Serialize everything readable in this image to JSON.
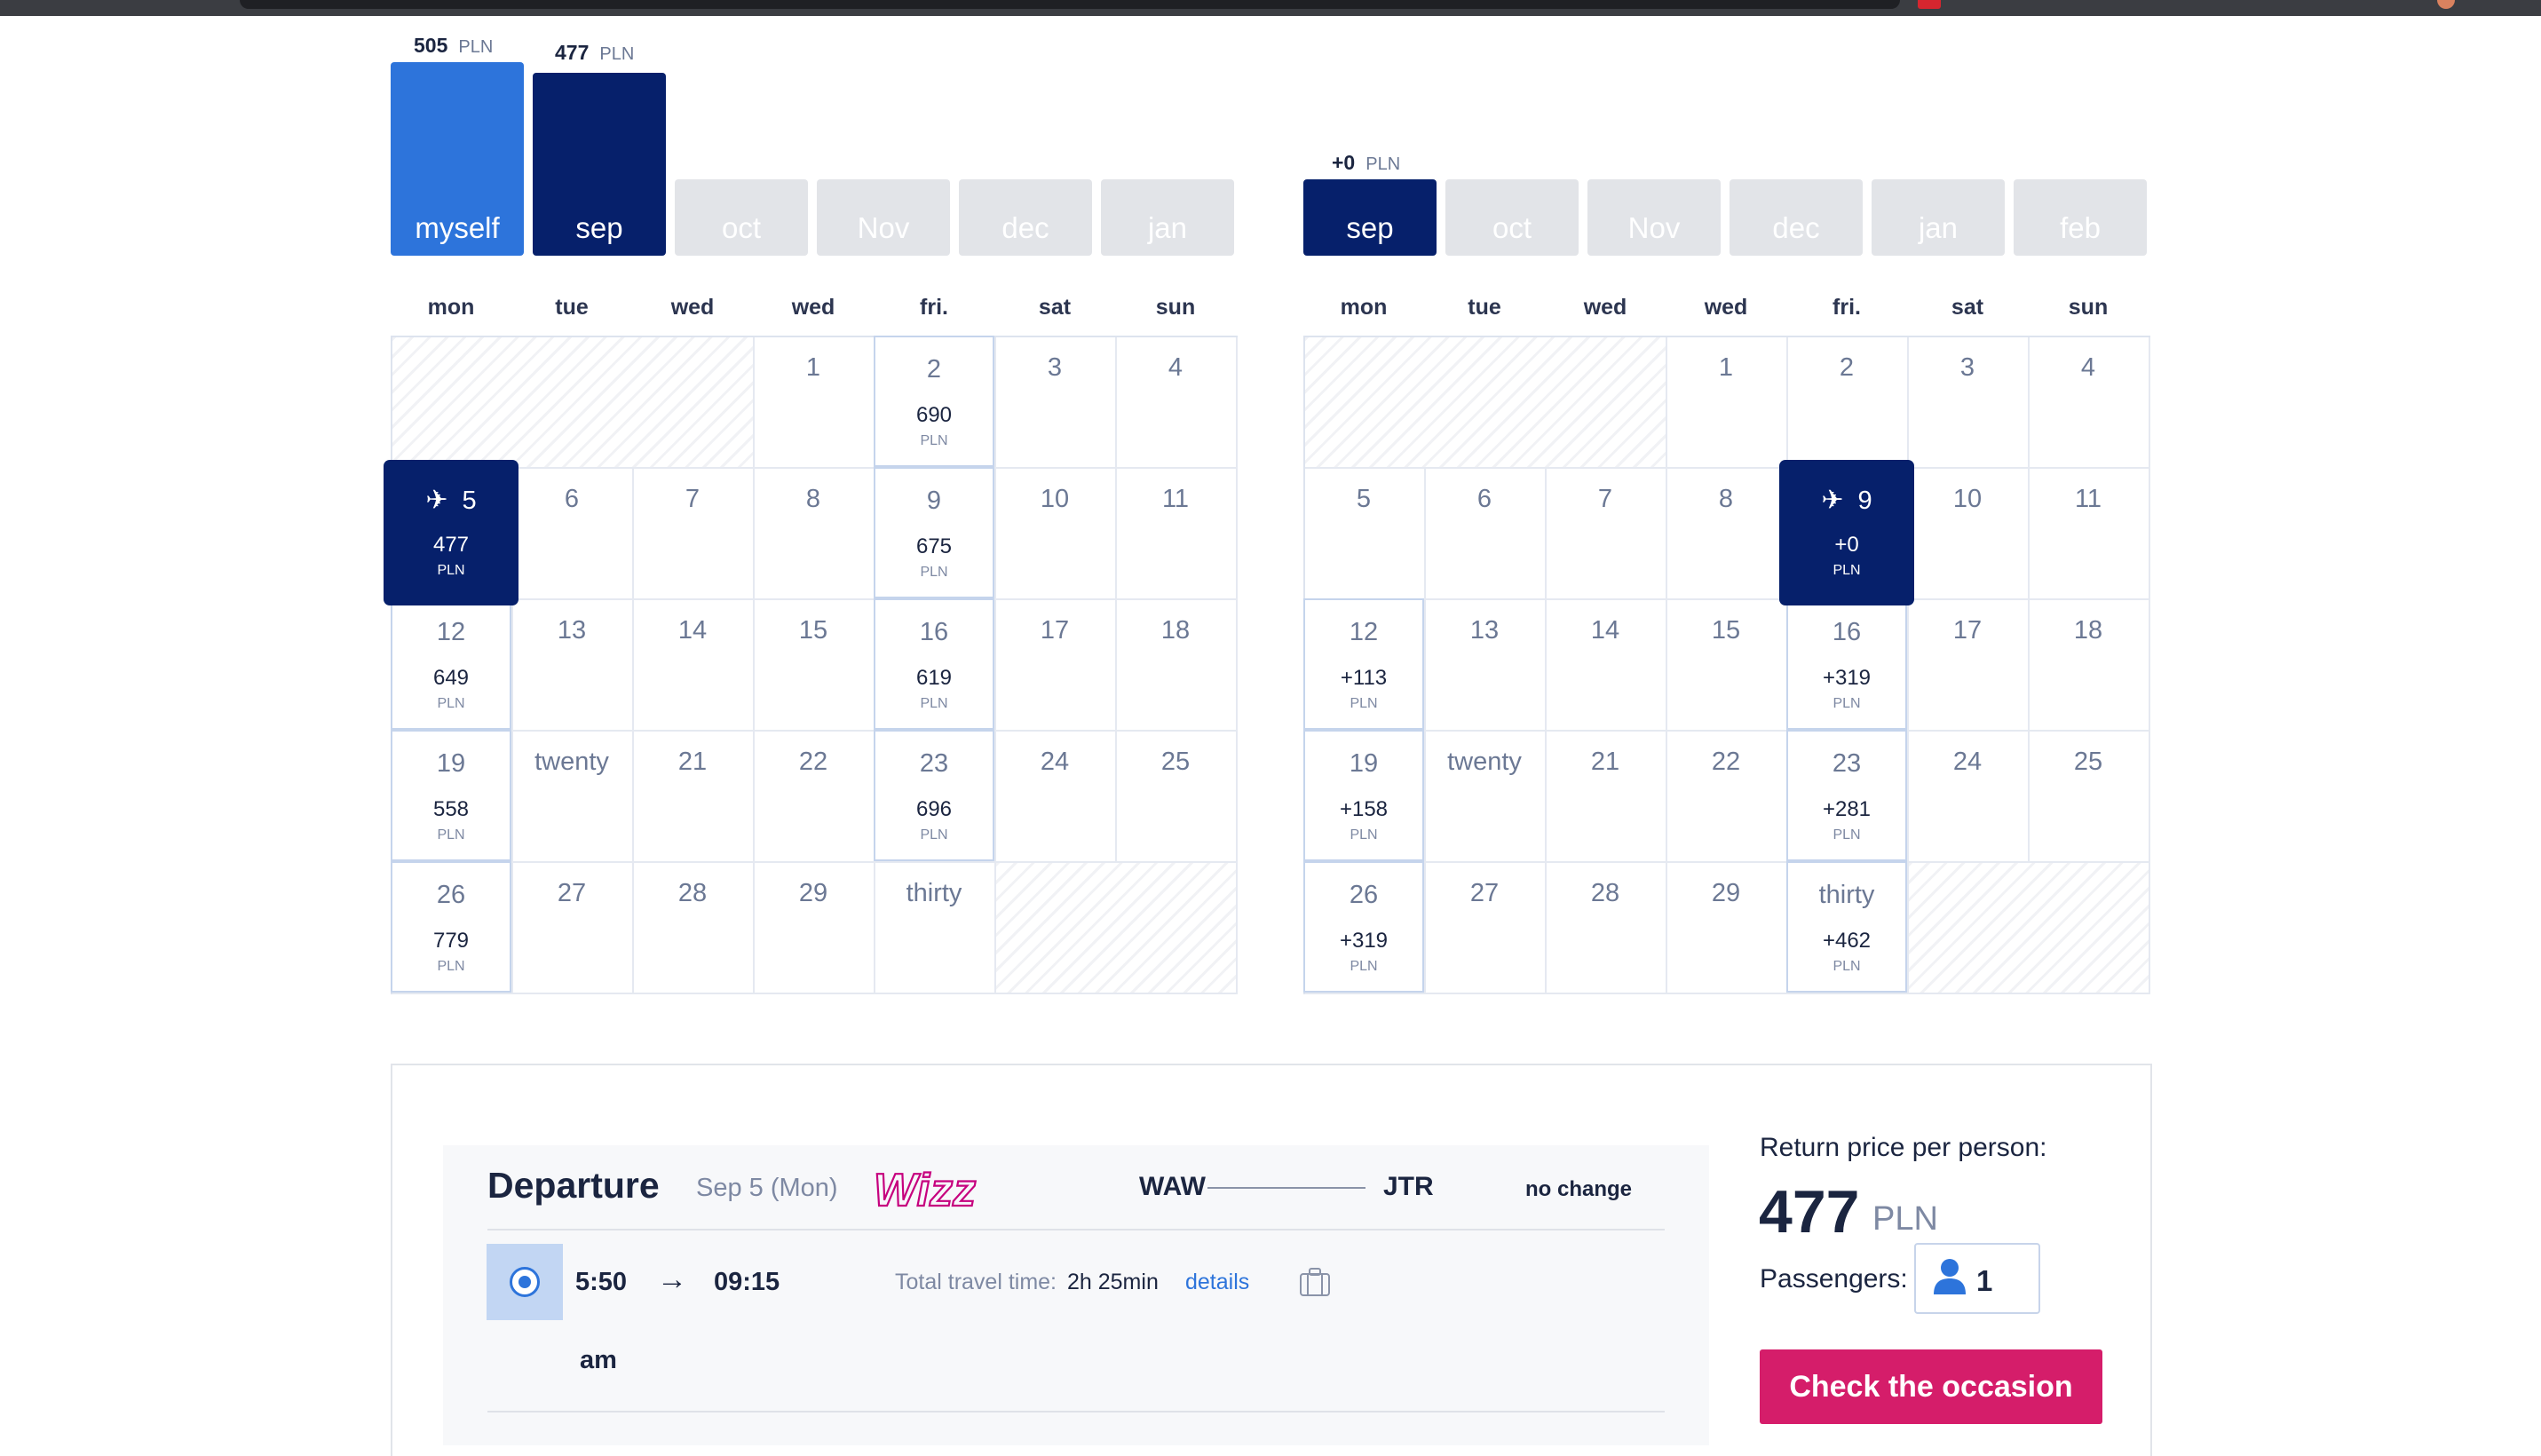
{
  "outbound": {
    "bars": [
      {
        "label": "myself",
        "price": "505",
        "currency": "PLN",
        "relative_height": 1.0
      },
      {
        "label": "sep",
        "price": "477",
        "currency": "PLN",
        "relative_height": 0.945
      }
    ],
    "months": [
      "oct",
      "Nov",
      "dec",
      "jan"
    ],
    "weekdays": [
      "mon",
      "tue",
      "wed",
      "wed",
      "fri.",
      "sat",
      "sun"
    ],
    "calendar": {
      "rows": [
        [
          {
            "d": ""
          },
          {
            "d": ""
          },
          {
            "d": ""
          },
          {
            "d": "1"
          },
          {
            "d": "2",
            "p": "690",
            "c": "PLN"
          },
          {
            "d": "3"
          },
          {
            "d": "4"
          }
        ],
        [
          {
            "d": "5",
            "p": "477",
            "c": "PLN",
            "selected": true
          },
          {
            "d": "6"
          },
          {
            "d": "7"
          },
          {
            "d": "8"
          },
          {
            "d": "9",
            "p": "675",
            "c": "PLN"
          },
          {
            "d": "10"
          },
          {
            "d": "11"
          }
        ],
        [
          {
            "d": "12",
            "p": "649",
            "c": "PLN"
          },
          {
            "d": "13"
          },
          {
            "d": "14"
          },
          {
            "d": "15"
          },
          {
            "d": "16",
            "p": "619",
            "c": "PLN"
          },
          {
            "d": "17"
          },
          {
            "d": "18"
          }
        ],
        [
          {
            "d": "19",
            "p": "558",
            "c": "PLN"
          },
          {
            "d": "twenty"
          },
          {
            "d": "21"
          },
          {
            "d": "22"
          },
          {
            "d": "23",
            "p": "696",
            "c": "PLN"
          },
          {
            "d": "24"
          },
          {
            "d": "25"
          }
        ],
        [
          {
            "d": "26",
            "p": "779",
            "c": "PLN"
          },
          {
            "d": "27"
          },
          {
            "d": "28"
          },
          {
            "d": "29"
          },
          {
            "d": "thirty"
          },
          {
            "d": ""
          },
          {
            "d": ""
          }
        ]
      ]
    }
  },
  "return": {
    "header_price": "+0",
    "header_currency": "PLN",
    "active_month": "sep",
    "months": [
      "oct",
      "Nov",
      "dec",
      "jan",
      "feb"
    ],
    "weekdays": [
      "mon",
      "tue",
      "wed",
      "wed",
      "fri.",
      "sat",
      "sun"
    ],
    "calendar": {
      "rows": [
        [
          {
            "d": ""
          },
          {
            "d": ""
          },
          {
            "d": ""
          },
          {
            "d": "1"
          },
          {
            "d": "2"
          },
          {
            "d": "3"
          },
          {
            "d": "4"
          }
        ],
        [
          {
            "d": "5"
          },
          {
            "d": "6"
          },
          {
            "d": "7"
          },
          {
            "d": "8"
          },
          {
            "d": "9",
            "p": "+0",
            "c": "PLN",
            "selected": true
          },
          {
            "d": "10"
          },
          {
            "d": "11"
          }
        ],
        [
          {
            "d": "12",
            "p": "+113",
            "c": "PLN"
          },
          {
            "d": "13"
          },
          {
            "d": "14"
          },
          {
            "d": "15"
          },
          {
            "d": "16",
            "p": "+319",
            "c": "PLN"
          },
          {
            "d": "17"
          },
          {
            "d": "18"
          }
        ],
        [
          {
            "d": "19",
            "p": "+158",
            "c": "PLN"
          },
          {
            "d": "twenty"
          },
          {
            "d": "21"
          },
          {
            "d": "22"
          },
          {
            "d": "23",
            "p": "+281",
            "c": "PLN"
          },
          {
            "d": "24"
          },
          {
            "d": "25"
          }
        ],
        [
          {
            "d": "26",
            "p": "+319",
            "c": "PLN"
          },
          {
            "d": "27"
          },
          {
            "d": "28"
          },
          {
            "d": "29"
          },
          {
            "d": "thirty",
            "p": "+462",
            "c": "PLN"
          },
          {
            "d": ""
          },
          {
            "d": ""
          }
        ]
      ]
    }
  },
  "flight": {
    "title": "Departure",
    "date": "Sep 5 (Mon)",
    "airline_logo": "wizz-logo",
    "from": "WAW",
    "to": "JTR",
    "stops": "no change",
    "depart_time": "5:50",
    "depart_suffix": "am",
    "arrow": "→",
    "arrive_time": "09:15",
    "total_label": "Total travel time:",
    "total_value": "2h 25min",
    "details_link": "details",
    "bag_icon": "luggage-icon"
  },
  "summary": {
    "return_label": "Return price per person:",
    "amount": "477",
    "currency": "PLN",
    "passengers_label": "Passengers:",
    "passenger_icon": "person-icon",
    "passenger_count": "1",
    "cta": "Check the occasion"
  },
  "colors": {
    "navy": "#06206b",
    "blue": "#2d74db",
    "inactive_tab": "#e2e4e8",
    "cta": "#d51d6a"
  }
}
